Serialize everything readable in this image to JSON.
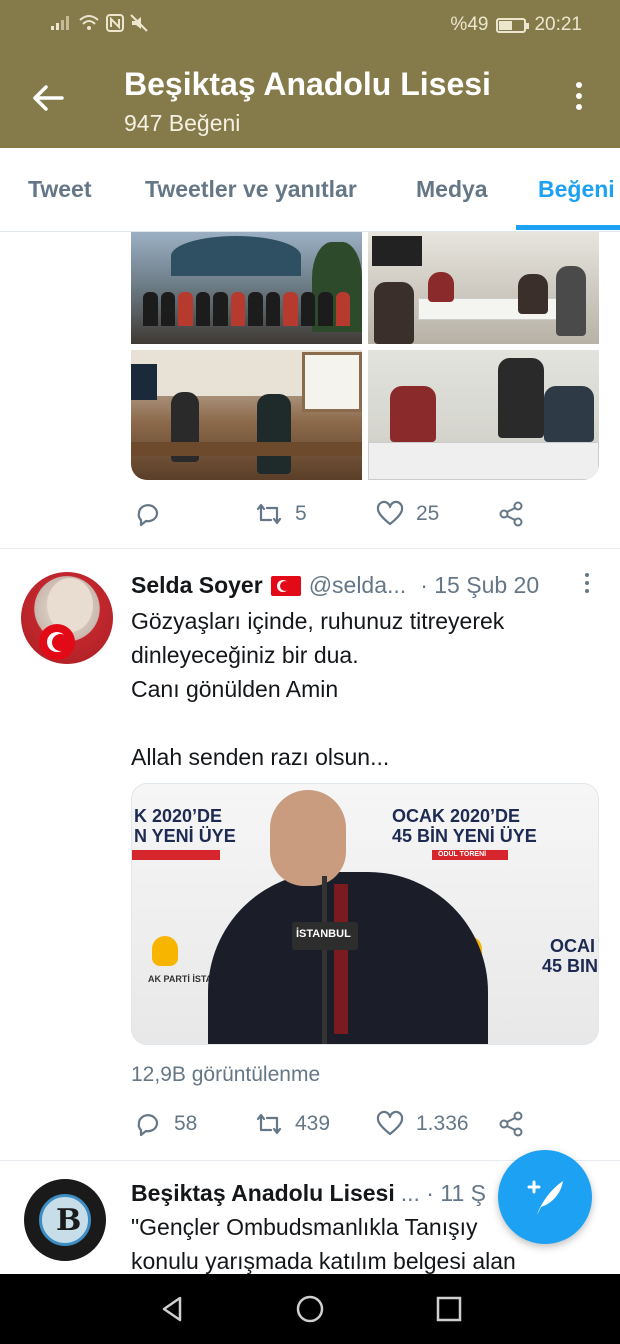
{
  "status_bar": {
    "battery_text": "%49",
    "battery_level": 0.49,
    "time": "20:21",
    "icons": [
      "signal-icon",
      "wifi-icon",
      "nfc-icon",
      "mute-icon",
      "battery-icon"
    ]
  },
  "header": {
    "back_icon": "arrow-left-icon",
    "title": "Beşiktaş Anadolu Lisesi",
    "subtitle": "947 Beğeni",
    "menu_icon": "more-vertical-icon",
    "bg_color": "#857a4a"
  },
  "tabs": [
    {
      "label": "Tweet",
      "active": false
    },
    {
      "label": "Tweetler ve yanıtlar",
      "active": false
    },
    {
      "label": "Medya",
      "active": false
    },
    {
      "label": "Beğeni",
      "active": true
    }
  ],
  "accent_color": "#1da1f2",
  "tweet1": {
    "actions": {
      "reply": "",
      "retweet": "5",
      "like": "25",
      "share_icon": "share-icon"
    }
  },
  "tweet2": {
    "name": "Selda Soyer",
    "handle": "@selda...",
    "date": "· 15 Şub 20",
    "text": [
      "Gözyaşları içinde, ruhunuz titreyerek",
      "dinleyeceğiniz bir dua.",
      "Canı gönülden Amin",
      "",
      "Allah senden razı olsun..."
    ],
    "video": {
      "banner_left_1": "K 2020’DE",
      "banner_left_2": "N YENİ ÜYE",
      "banner_right_1": "OCAK 2020’DE",
      "banner_right_2": "45 BİN YENİ ÜYE",
      "banner_right_small": "ÖDÜL TÖRENİ",
      "banner_far_1": "OCAI",
      "banner_far_2": "45 BIN",
      "podium": "İSTANBUL",
      "party_label": "AK PARTİ İSTANBUL"
    },
    "views": "12,9B görüntülenme",
    "actions": {
      "reply": "58",
      "retweet": "439",
      "like": "1.336",
      "share_icon": "share-icon"
    }
  },
  "tweet3": {
    "name": "Beşiktaş Anadolu Lisesi",
    "date_partial": "... · 11 Ş",
    "text": [
      "\"Gençler Ombudsmanlıkla Tanışıy",
      "konulu yarışmada katılım belgesi alan"
    ]
  },
  "fab_icon": "compose-feather-icon",
  "nav": {
    "back_icon": "nav-back-icon",
    "home_icon": "nav-home-icon",
    "recents_icon": "nav-recents-icon"
  }
}
